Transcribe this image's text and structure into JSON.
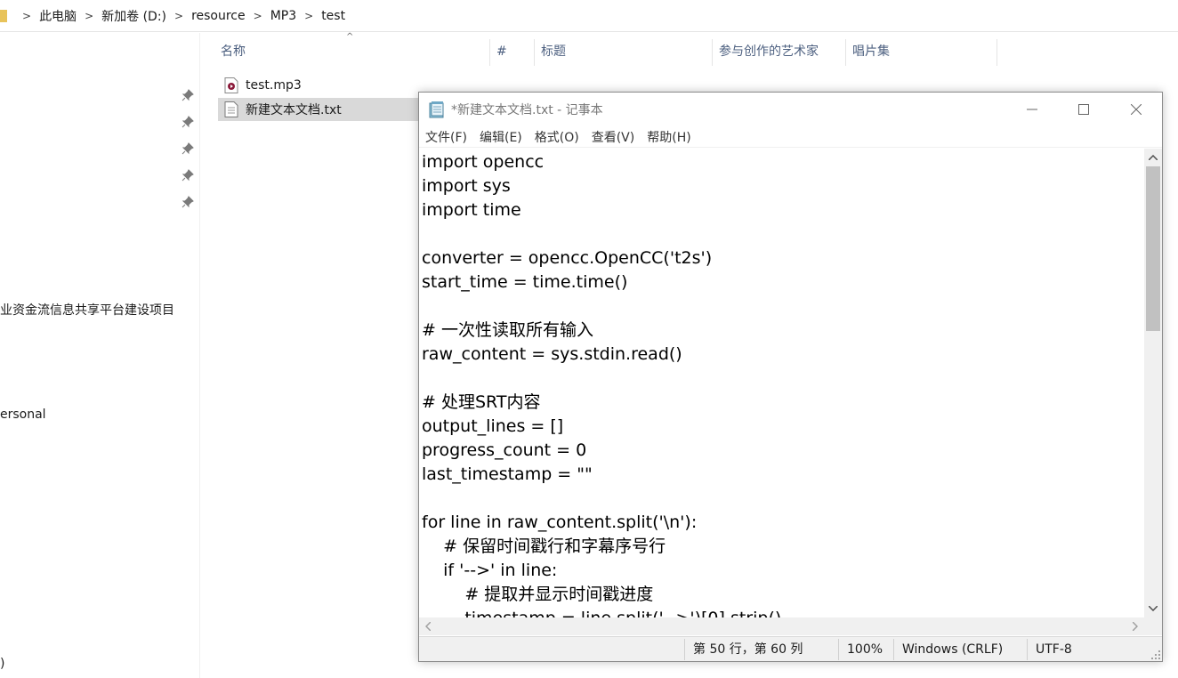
{
  "explorer": {
    "breadcrumb": [
      "此电脑",
      "新加卷 (D:)",
      "resource",
      "MP3",
      "test"
    ],
    "nav_items": {
      "item1": "业资金流信息共享平台建设项目",
      "item2": "ersonal",
      "item3": ")"
    },
    "columns": {
      "name": "名称",
      "number": "#",
      "title": "标题",
      "artists": "参与创作的艺术家",
      "album": "唱片集"
    },
    "files": [
      {
        "name": "test.mp3",
        "icon": "audio-file-icon"
      },
      {
        "name": "新建文本文档.txt",
        "icon": "text-file-icon",
        "selected": true
      }
    ]
  },
  "notepad": {
    "title": "*新建文本文档.txt - 记事本",
    "menu": [
      "文件(F)",
      "编辑(E)",
      "格式(O)",
      "查看(V)",
      "帮助(H)"
    ],
    "content": "import opencc\nimport sys\nimport time\n\nconverter = opencc.OpenCC('t2s')\nstart_time = time.time()\n\n# 一次性读取所有输入\nraw_content = sys.stdin.read()\n\n# 处理SRT内容\noutput_lines = []\nprogress_count = 0\nlast_timestamp = \"\"\n\nfor line in raw_content.split('\\n'):\n    # 保留时间戳行和字幕序号行\n    if '-->' in line:\n        # 提取并显示时间戳进度\n        timestamp = line.split('-->')[0].strip()",
    "status": {
      "position": "第 50 行，第 60 列",
      "zoom": "100%",
      "line_ending": "Windows (CRLF)",
      "encoding": "UTF-8"
    }
  },
  "colors": {
    "selection": "#d9d9d9",
    "folder": "#e8c35a",
    "header_text": "#4d6080"
  }
}
